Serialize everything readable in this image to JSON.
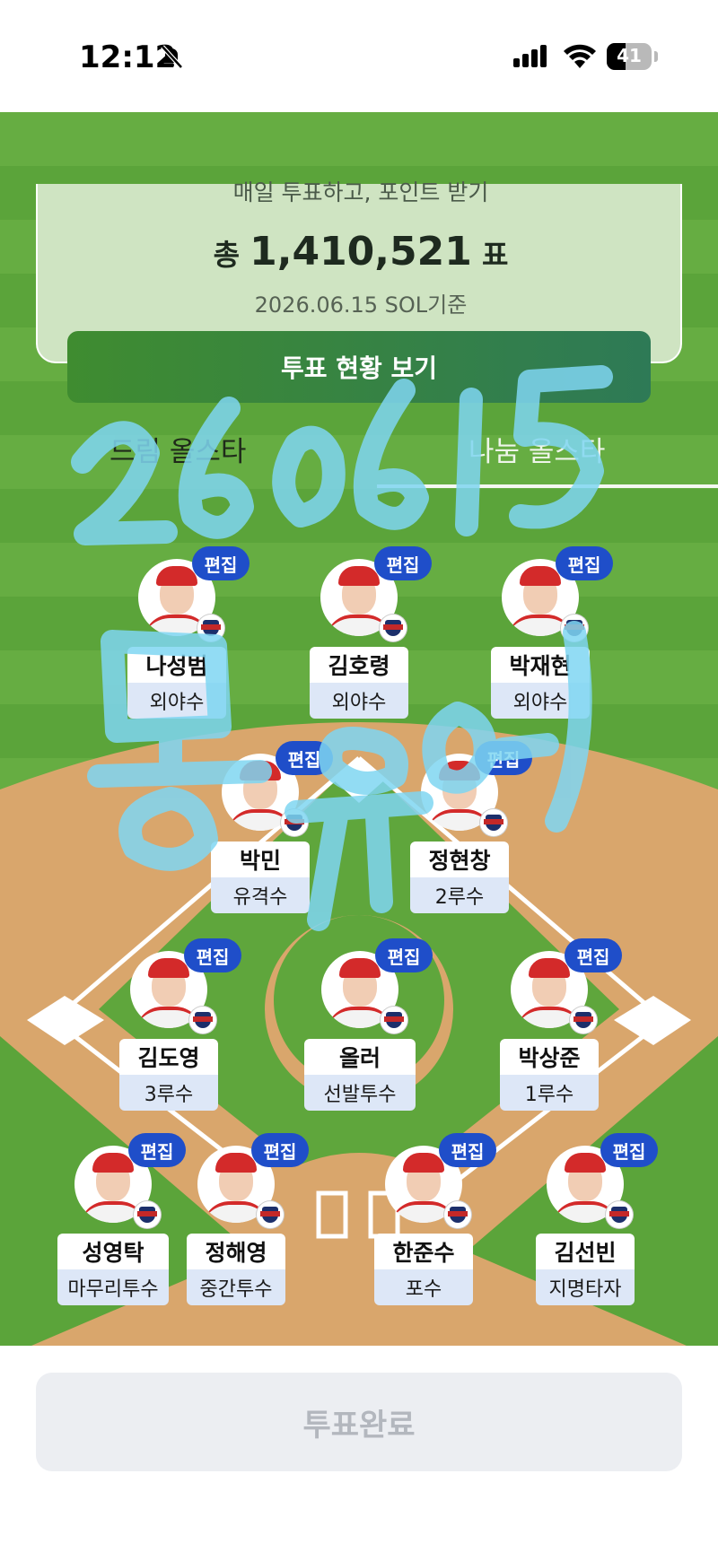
{
  "status_bar": {
    "time": "12:12",
    "battery": "41"
  },
  "summary": {
    "heading": "매일 투표하고, 포인트 받기",
    "total_prefix": "총",
    "total_votes": "1,410,521",
    "total_suffix": "표",
    "basis": "2026.06.15 SOL기준",
    "status_button": "투표 현황 보기"
  },
  "tabs": [
    {
      "label": "드림 올스타",
      "active": false
    },
    {
      "label": "나눔 올스타",
      "active": true
    }
  ],
  "edit_label": "편집",
  "players": [
    {
      "name": "나성범",
      "position": "외야수"
    },
    {
      "name": "김호령",
      "position": "외야수"
    },
    {
      "name": "박재현",
      "position": "외야수"
    },
    {
      "name": "박민",
      "position": "유격수"
    },
    {
      "name": "정현창",
      "position": "2루수"
    },
    {
      "name": "김도영",
      "position": "3루수"
    },
    {
      "name": "올러",
      "position": "선발투수"
    },
    {
      "name": "박상준",
      "position": "1루수"
    },
    {
      "name": "성영탁",
      "position": "마무리투수"
    },
    {
      "name": "정해영",
      "position": "중간투수"
    },
    {
      "name": "한준수",
      "position": "포수"
    },
    {
      "name": "김선빈",
      "position": "지명타자"
    }
  ],
  "handwriting": "26.06.15 몽유",
  "colors": {
    "edit_badge": "#1f4ec9",
    "field_green": "#5aa33a",
    "infield_dirt": "#d9a66c",
    "handwriting": "#7fd6f2"
  },
  "done_button": "투표완료"
}
